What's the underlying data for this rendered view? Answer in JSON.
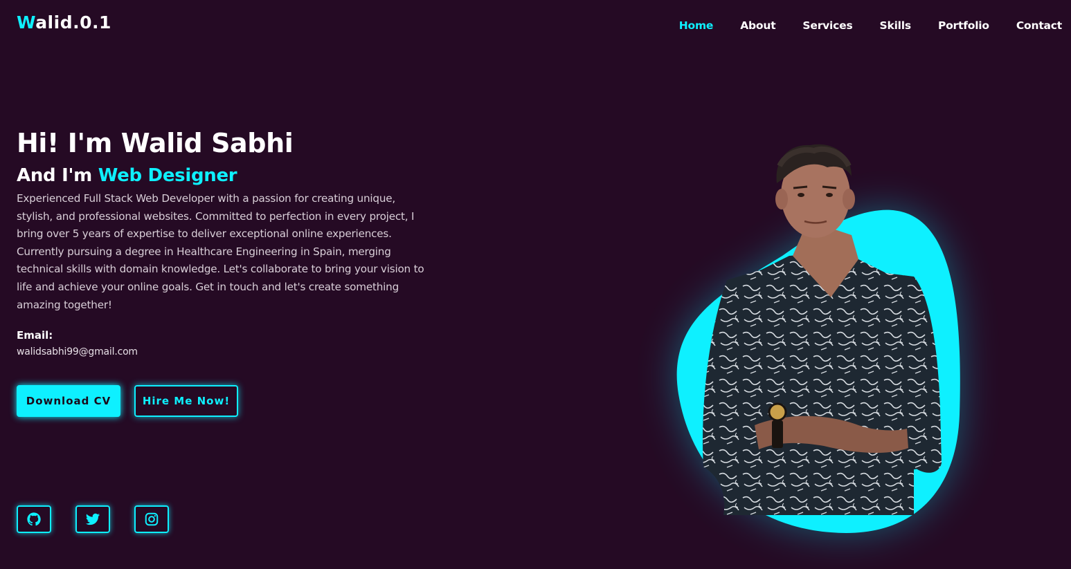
{
  "header": {
    "logo_first": "W",
    "logo_rest": "alid.0.1",
    "nav": [
      {
        "label": "Home",
        "active": true
      },
      {
        "label": "About",
        "active": false
      },
      {
        "label": "Services",
        "active": false
      },
      {
        "label": "Skills",
        "active": false
      },
      {
        "label": "Portfolio",
        "active": false
      },
      {
        "label": "Contact",
        "active": false
      }
    ]
  },
  "hero": {
    "greeting": "Hi! I'm Walid Sabhi",
    "subtitle_prefix": "And I'm ",
    "subtitle_role": "Web Designer",
    "description": "Experienced Full Stack Web Developer with a passion for creating unique, stylish, and professional websites. Committed to perfection in every project, I bring over 5 years of expertise to deliver exceptional online experiences. Currently pursuing a degree in Healthcare Engineering in Spain, merging technical skills with domain knowledge. Let's collaborate to bring your vision to life and achieve your online goals. Get in touch and let's create something amazing together!",
    "email_label": "Email:",
    "email_value": "walidsabhi99@gmail.com",
    "download_button": "Download CV",
    "hire_button": "Hire Me Now!"
  },
  "socials": [
    {
      "icon": "github-icon"
    },
    {
      "icon": "twitter-icon"
    },
    {
      "icon": "instagram-icon"
    }
  ],
  "colors": {
    "background": "#250a24",
    "accent": "#0ef0ff",
    "text": "#ffffff"
  }
}
